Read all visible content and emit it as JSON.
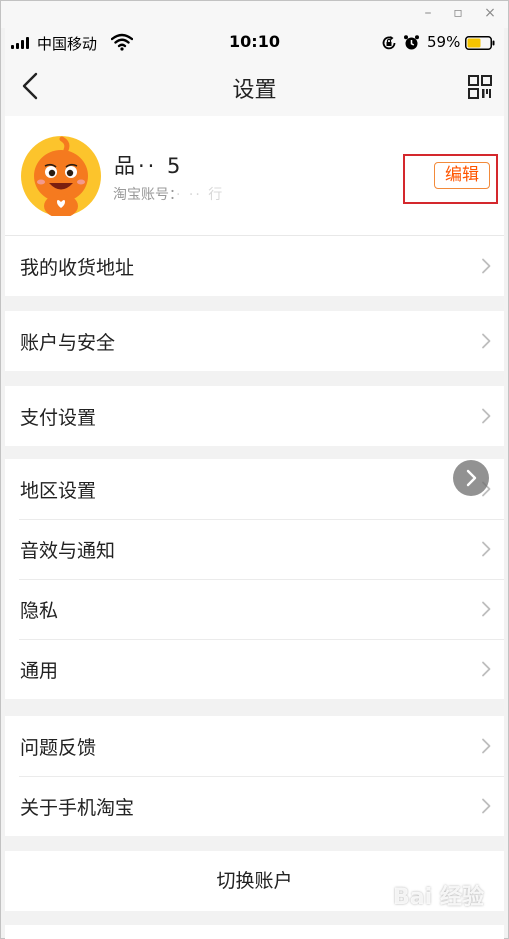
{
  "status_bar": {
    "carrier": "中国移动",
    "time": "10:10",
    "battery_percent": "59%",
    "battery_level": 0.59,
    "battery_color": "#f5c400"
  },
  "nav": {
    "title": "设置"
  },
  "profile": {
    "username": "品·· 5",
    "account_label": "淘宝账号：",
    "account_value": "·  ·· 行",
    "edit_label": "编辑",
    "accent_color": "#ff5500"
  },
  "groups": [
    {
      "items": [
        {
          "label": "我的收货地址"
        }
      ]
    },
    {
      "items": [
        {
          "label": "账户与安全"
        }
      ]
    },
    {
      "items": [
        {
          "label": "支付设置"
        }
      ]
    },
    {
      "items": [
        {
          "label": "地区设置"
        },
        {
          "label": "音效与通知"
        },
        {
          "label": "隐私"
        },
        {
          "label": "通用"
        }
      ]
    },
    {
      "items": [
        {
          "label": "问题反馈"
        },
        {
          "label": "关于手机淘宝"
        }
      ]
    }
  ],
  "switch_account": {
    "label": "切换账户"
  },
  "icons": {
    "back": "chevron-left-icon",
    "qr": "qr-code-icon",
    "row": "chevron-right-icon"
  },
  "watermark": {
    "text": "Bai 经验"
  }
}
